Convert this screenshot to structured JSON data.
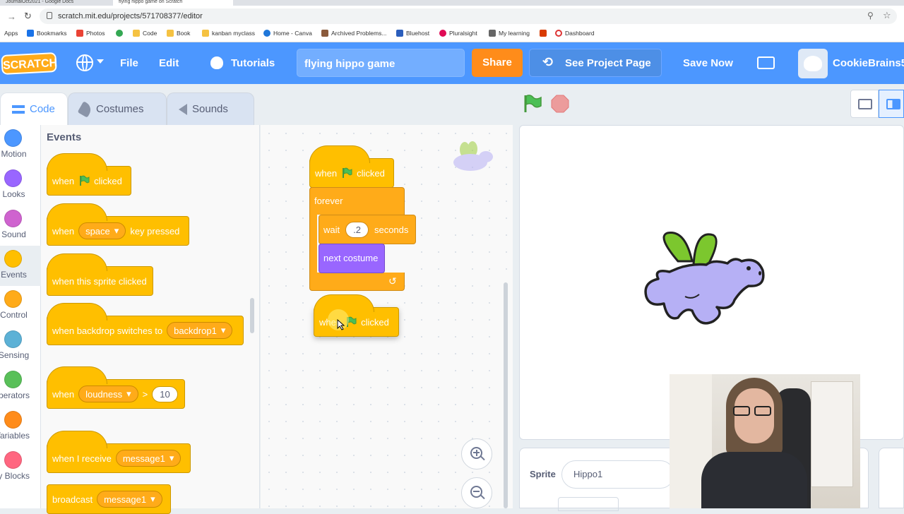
{
  "browser": {
    "tabs": [
      "JournalOct2021 - Google Docs",
      "flying hippo game on Scratch"
    ],
    "url": "scratch.mit.edu/projects/571708377/editor",
    "bookmarks": [
      "Apps",
      "Bookmarks",
      "Photos",
      "",
      "Code",
      "Book",
      "kanban myclass",
      "Home - Canva",
      "Archived Problems...",
      "Bluehost",
      "Pluralsight",
      "My learning",
      "",
      "Dashboard"
    ]
  },
  "menubar": {
    "logo": "SCRATCH",
    "file": "File",
    "edit": "Edit",
    "tutorials": "Tutorials",
    "project_title": "flying hippo game",
    "share": "Share",
    "see_project_page": "See Project Page",
    "save_now": "Save Now",
    "username": "CookieBrains5"
  },
  "editor_tabs": {
    "code": "Code",
    "costumes": "Costumes",
    "sounds": "Sounds"
  },
  "categories": [
    {
      "label": "Motion",
      "color": "#4c97ff"
    },
    {
      "label": "Looks",
      "color": "#9966ff"
    },
    {
      "label": "Sound",
      "color": "#cf63cf"
    },
    {
      "label": "Events",
      "color": "#ffbf00"
    },
    {
      "label": "Control",
      "color": "#ffab19"
    },
    {
      "label": "Sensing",
      "color": "#5cb1d6"
    },
    {
      "label": "Operators",
      "color": "#59c059"
    },
    {
      "label": "Variables",
      "color": "#ff8c1a"
    },
    {
      "label": "My Blocks",
      "color": "#ff6680"
    }
  ],
  "palette": {
    "heading": "Events",
    "when": "when",
    "clicked": "clicked",
    "space": "space",
    "key_pressed": "key pressed",
    "this_sprite_clicked": "when this sprite clicked",
    "backdrop_switches": "when backdrop switches to",
    "backdrop1": "backdrop1",
    "loudness": "loudness",
    "gt": ">",
    "ten": "10",
    "when_i_receive": "when I receive",
    "message1": "message1",
    "broadcast": "broadcast"
  },
  "script": {
    "when": "when",
    "clicked": "clicked",
    "forever": "forever",
    "wait": "wait",
    "wait_value": ".2",
    "seconds": "seconds",
    "next_costume": "next costume"
  },
  "sprite_info": {
    "label": "Sprite",
    "name": "Hippo1"
  },
  "colors": {
    "menu_blue": "#4c97ff",
    "events_yellow": "#ffbf00",
    "control_orange": "#ffab19",
    "looks_purple": "#9966ff",
    "share_orange": "#ff8c1a"
  }
}
